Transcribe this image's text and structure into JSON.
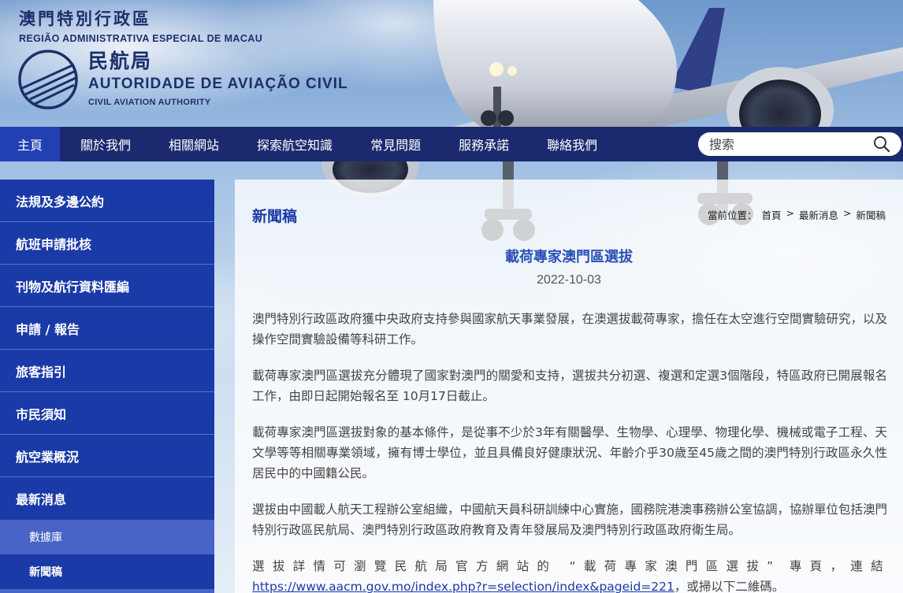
{
  "header": {
    "region_zh": "澳門特別行政區",
    "region_pt": "REGIÃO ADMINISTRATIVA ESPECIAL DE MACAU",
    "authority_zh": "民航局",
    "authority_pt": "AUTORIDADE DE AVIAÇÃO CIVIL",
    "authority_en": "CIVIL AVIATION AUTHORITY"
  },
  "nav": {
    "items": [
      "主頁",
      "關於我們",
      "相關網站",
      "探索航空知識",
      "常見問題",
      "服務承諾",
      "聯絡我們"
    ],
    "search_placeholder": "搜索"
  },
  "sidebar": {
    "items": [
      "法規及多邊公約",
      "航班申請批核",
      "刊物及航行資料匯編",
      "申請 / 報告",
      "旅客指引",
      "市民須知",
      "航空業概況",
      "最新消息"
    ],
    "sub_items": [
      "數據庫",
      "新聞稿"
    ]
  },
  "main": {
    "section_title": "新聞稿",
    "breadcrumb": {
      "label": "當前位置：",
      "items": [
        "首頁",
        "最新消息",
        "新聞稿"
      ],
      "separator": ">"
    },
    "article": {
      "title": "載荷專家澳門區選拔",
      "date": "2022-10-03",
      "paragraphs": [
        "澳門特別行政區政府獲中央政府支持參與國家航天事業發展，在澳選拔載荷專家，擔任在太空進行空間實驗研究，以及操作空間實驗設備等科研工作。",
        "載荷專家澳門區選拔充分體現了國家對澳門的關愛和支持，選拔共分初選、複選和定選3個階段，特區政府已開展報名工作，由即日起開始報名至 10月17日截止。",
        "載荷專家澳門區選拔對象的基本條件，是從事不少於3年有關醫學、生物學、心理學、物理化學、機械或電子工程、天文學等等相關專業領域，擁有博士學位，並且具備良好健康狀況、年齡介乎30歲至45歲之間的澳門特別行政區永久性居民中的中國籍公民。",
        "選拔由中國載人航天工程辦公室組織，中國航天員科研訓練中心實施，國務院港澳事務辦公室協調，協辦單位包括澳門特別行政區民航局、澳門特別行政區政府教育及青年發展局及澳門特別行政區政府衛生局。"
      ],
      "last_paragraph_pre": "選拔詳情可瀏覽民航局官方網站的 “載荷專家澳門區選拔” 專頁，連結",
      "link": "https://www.aacm.gov.mo/index.php?r=selection/index&pageid=221",
      "last_paragraph_post": "，或掃以下二維碼。"
    }
  },
  "colors": {
    "nav_bg": "#1b2a6e",
    "nav_active": "#2340b3",
    "sidebar_bg": "#1a3aa8",
    "sidebar_sub": "#4864c6",
    "title_blue": "#1d3aa6"
  }
}
